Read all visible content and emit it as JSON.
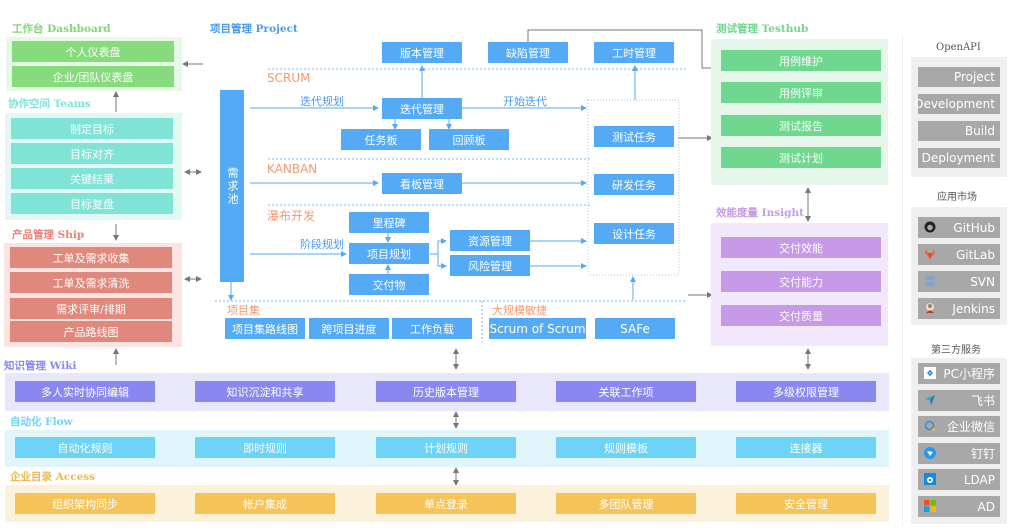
{
  "dashboard": {
    "title_cn": "工作台",
    "title_en": "Dashboard",
    "items": [
      "个人仪表盘",
      "企业/团队仪表盘"
    ]
  },
  "teams": {
    "title_cn": "协作空间",
    "title_en": "Teams",
    "items": [
      "制定目标",
      "目标对齐",
      "关键结果",
      "目标复盘"
    ]
  },
  "ship": {
    "title_cn": "产品管理",
    "title_en": "Ship",
    "items": [
      "工单及需求收集",
      "工单及需求清洗",
      "需求评审/排期",
      "产品路线图"
    ]
  },
  "project": {
    "title_cn": "项目管理",
    "title_en": "Project",
    "top_boxes": [
      "版本管理",
      "缺陷管理",
      "工时管理"
    ],
    "backlog": "需求池",
    "scrum": {
      "label": "SCRUM",
      "plan_label": "迭代规划",
      "start_label": "开始迭代",
      "iteration": "迭代管理",
      "task_board": "任务板",
      "retro_board": "回顾板"
    },
    "kanban": {
      "label": "KANBAN",
      "board": "看板管理"
    },
    "waterfall": {
      "label": "瀑布开发",
      "phase_label": "阶段规划",
      "milestone": "里程碑",
      "plan": "项目规划",
      "deliverable": "交付物",
      "resource": "资源管理",
      "risk": "风险管理"
    },
    "tasks": [
      "测试任务",
      "研发任务",
      "设计任务"
    ],
    "portfolio": {
      "label": "项目集",
      "items": [
        "项目集路线图",
        "跨项目进度",
        "工作负载"
      ]
    },
    "scaled": {
      "label": "大规模敏捷",
      "items": [
        "Scrum of Scrum",
        "SAFe"
      ]
    }
  },
  "testhub": {
    "title_cn": "测试管理",
    "title_en": "Testhub",
    "items": [
      "用例维护",
      "用例评审",
      "测试报告",
      "测试计划"
    ]
  },
  "insight": {
    "title_cn": "效能度量",
    "title_en": "Insight",
    "items": [
      "交付效能",
      "交付能力",
      "交付质量"
    ]
  },
  "wiki": {
    "title_cn": "知识管理",
    "title_en": "Wiki",
    "items": [
      "多人实时协同编辑",
      "知识沉淀和共享",
      "历史版本管理",
      "关联工作项",
      "多级权限管理"
    ]
  },
  "flow": {
    "title_cn": "自动化",
    "title_en": "Flow",
    "items": [
      "自动化规则",
      "即时规则",
      "计划规则",
      "规则模板",
      "连接器"
    ]
  },
  "access": {
    "title_cn": "企业目录",
    "title_en": "Access",
    "items": [
      "组织架构同步",
      "帐户集成",
      "单点登录",
      "多团队管理",
      "安全管理"
    ]
  },
  "openapi": {
    "title": "OpenAPI",
    "items": [
      "Project",
      "Development",
      "Build",
      "Deployment"
    ]
  },
  "market": {
    "title": "应用市场",
    "items": [
      {
        "label": "GitHub",
        "icon": "github-icon"
      },
      {
        "label": "GitLab",
        "icon": "gitlab-icon"
      },
      {
        "label": "SVN",
        "icon": "svn-icon"
      },
      {
        "label": "Jenkins",
        "icon": "jenkins-icon"
      }
    ]
  },
  "thirdparty": {
    "title": "第三方服务",
    "items": [
      {
        "label": "PC小程序",
        "icon": "mini-program-icon"
      },
      {
        "label": "飞书",
        "icon": "feishu-icon"
      },
      {
        "label": "企业微信",
        "icon": "wecom-icon"
      },
      {
        "label": "钉钉",
        "icon": "dingtalk-icon"
      },
      {
        "label": "LDAP",
        "icon": "ldap-icon"
      },
      {
        "label": "AD",
        "icon": "ad-icon"
      }
    ]
  },
  "colors": {
    "dashboard": "#86dc7c",
    "teams": "#7fe3d6",
    "ship": "#e0887c",
    "project": "#55aaf5",
    "testhub": "#6fd88e",
    "insight": "#c69ae8",
    "wiki": "#8a88f0",
    "flow": "#6dd3f7",
    "access": "#f5c357",
    "gray": "#a8a8a8"
  }
}
